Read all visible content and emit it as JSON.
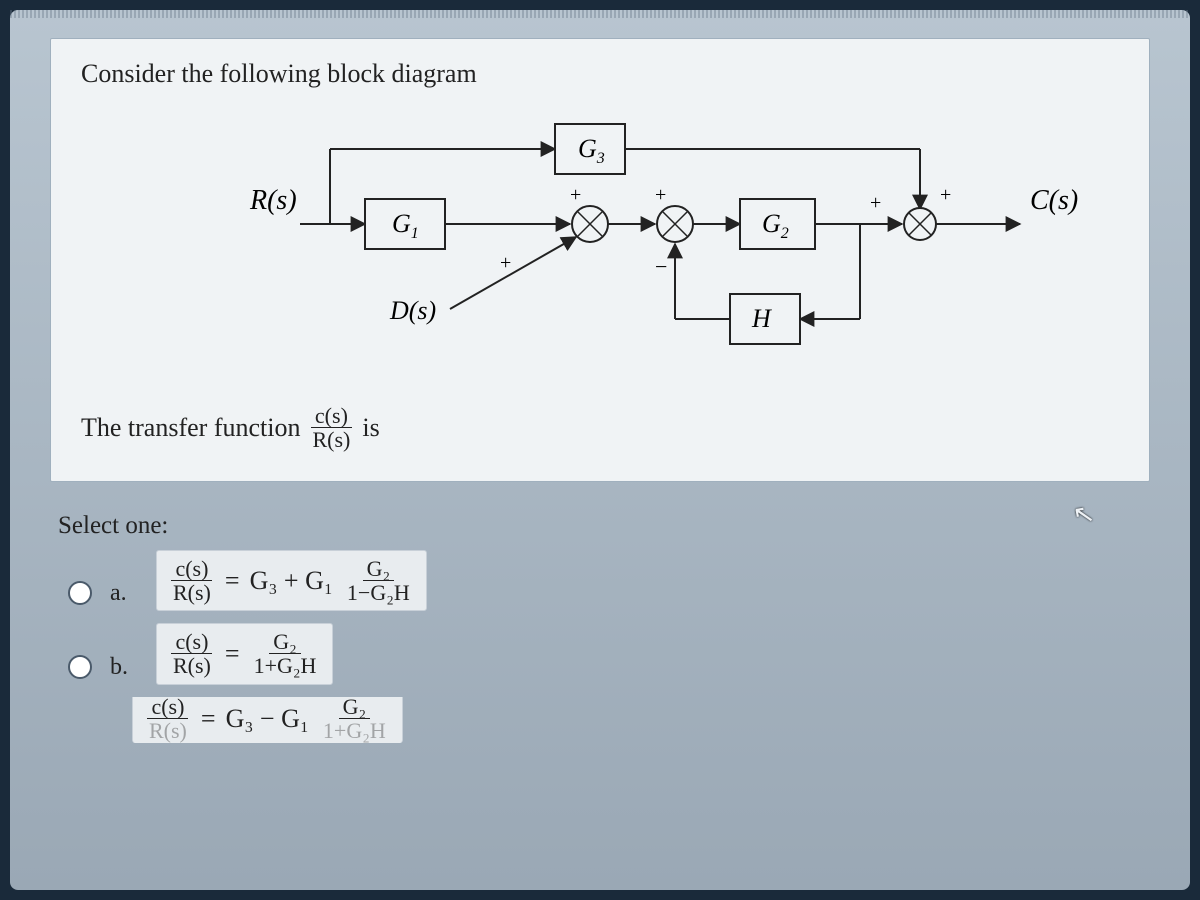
{
  "question": {
    "prompt": "Consider the following block diagram",
    "tf_phrase_pre": "The transfer function",
    "tf_frac_num": "c(s)",
    "tf_frac_den": "R(s)",
    "tf_phrase_post": "is"
  },
  "diagram": {
    "input_label": "R(s)",
    "output_label": "C(s)",
    "disturbance_label": "D(s)",
    "blocks": {
      "g1": "G₁",
      "g2": "G₂",
      "g3": "G₃",
      "h": "H"
    },
    "sum1": {
      "top": "+",
      "bottom": "+"
    },
    "sum2": {
      "top": "+",
      "bottom": "−"
    },
    "sum3": {
      "top": "+",
      "side": "+"
    }
  },
  "select_label": "Select one:",
  "options": {
    "a": {
      "letter": "a.",
      "lhs_num": "c(s)",
      "lhs_den": "R(s)",
      "eq": "=",
      "term1": "G₃ + G₁",
      "rhs_num": "G₂",
      "rhs_den": "1−G₂H"
    },
    "b": {
      "letter": "b.",
      "lhs_num": "c(s)",
      "lhs_den": "R(s)",
      "eq": "=",
      "rhs_num": "G₂",
      "rhs_den": "1+G₂H"
    },
    "c": {
      "letter": "",
      "lhs_num": "c(s)",
      "lhs_den_partial": "R(s)",
      "eq": "=",
      "term1": "G₃ − G₁",
      "rhs_num": "G₂",
      "rhs_den_partial": "1+G₂H"
    }
  }
}
